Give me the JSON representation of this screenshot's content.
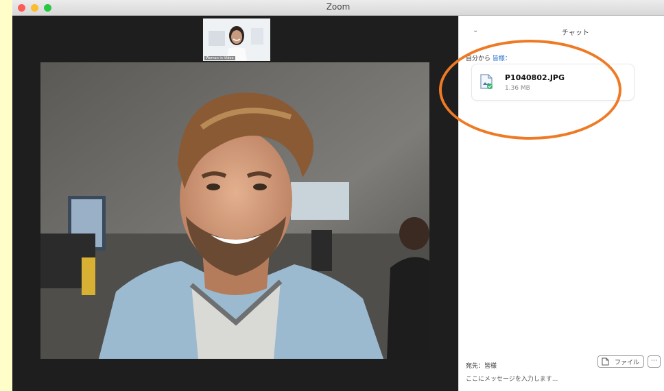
{
  "window": {
    "title": "Zoom"
  },
  "participants": {
    "thumbnail_name": "Woman in Video"
  },
  "chat": {
    "title": "チャット",
    "from_prefix": "自分から",
    "to_label": "皆様：",
    "file": {
      "name": "P1040802.JPG",
      "size": "1.36 MB"
    },
    "recipient_label": "宛先：皆様",
    "file_button_label": "ファイル",
    "more_label": "⋯",
    "message_placeholder": "ここにメッセージを入力します..."
  },
  "colors": {
    "accent_link": "#1f6fd1",
    "annotation": "#ef7a25",
    "success": "#2fb36b"
  }
}
